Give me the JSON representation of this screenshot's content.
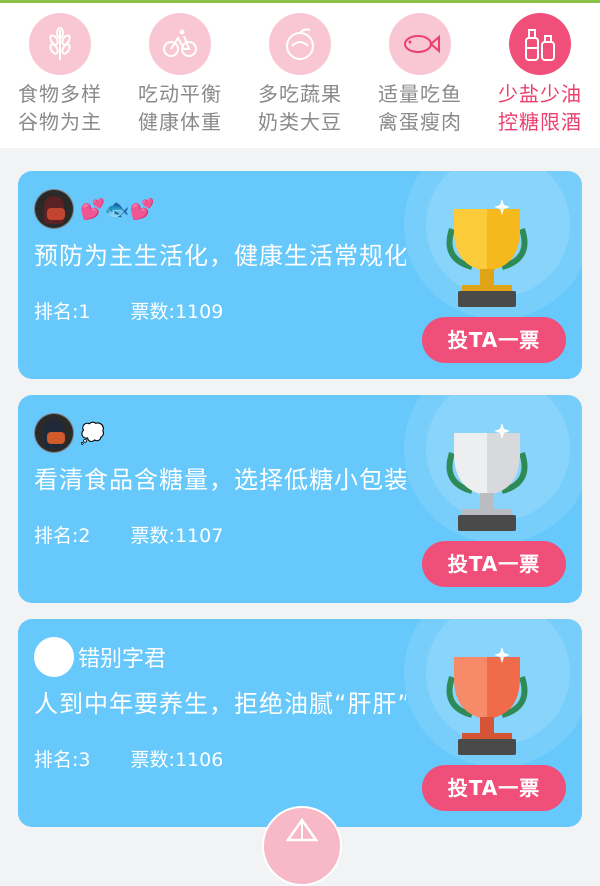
{
  "colors": {
    "accent_pink": "#ef4f78",
    "light_pink": "#f8c7d3",
    "card_blue": "#66c8fb",
    "inactive_text": "#8a8a8a"
  },
  "tabs": [
    {
      "line1": "食物多样",
      "line2": "谷物为主",
      "icon": "wheat-icon",
      "active": false
    },
    {
      "line1": "吃动平衡",
      "line2": "健康体重",
      "icon": "bicycle-icon",
      "active": false
    },
    {
      "line1": "多吃蔬果",
      "line2": "奶类大豆",
      "icon": "fruit-icon",
      "active": false
    },
    {
      "line1": "适量吃鱼",
      "line2": "禽蛋瘦肉",
      "icon": "fish-icon",
      "active": false
    },
    {
      "line1": "少盐少油",
      "line2": "控糖限酒",
      "icon": "bottles-icon",
      "active": true
    }
  ],
  "entries": [
    {
      "username": "",
      "emojis": "💕🐟💕",
      "title": "预防为主生活化，健康生活常规化",
      "rank_label": "排名:1",
      "votes_label": "票数:1109",
      "vote_button": "投TA一票",
      "trophy": "gold-trophy-icon"
    },
    {
      "username": "",
      "emojis": "💭",
      "title": "看清食品含糖量，选择低糖小包装",
      "rank_label": "排名:2",
      "votes_label": "票数:1107",
      "vote_button": "投TA一票",
      "trophy": "silver-trophy-icon"
    },
    {
      "username": "错别字君",
      "emojis": "",
      "title": "人到中年要养生，拒绝油腻“肝肝”",
      "rank_label": "排名:3",
      "votes_label": "票数:1106",
      "vote_button": "投TA一票",
      "trophy": "bronze-trophy-icon"
    }
  ]
}
